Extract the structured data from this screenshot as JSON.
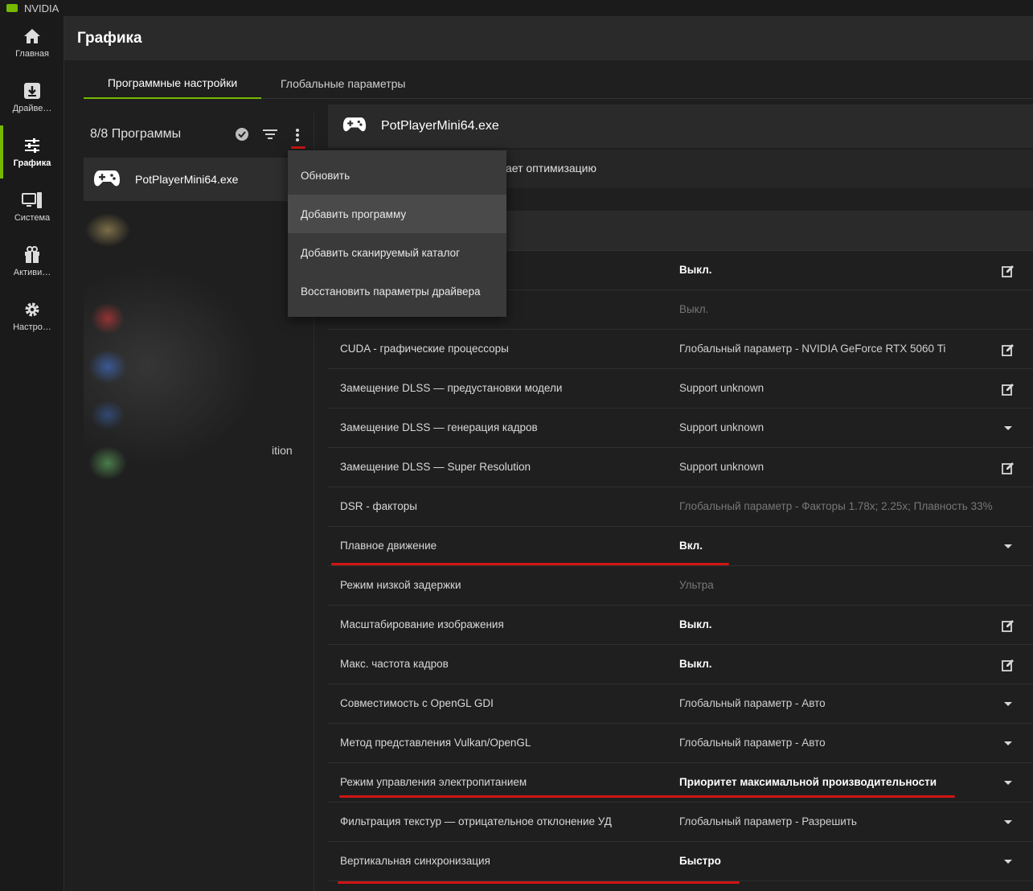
{
  "app": {
    "name": "NVIDIA",
    "page_title": "Графика"
  },
  "nav": [
    {
      "label": "Главная",
      "icon": "home-icon"
    },
    {
      "label": "Драйве…",
      "icon": "driver-icon"
    },
    {
      "label": "Графика",
      "icon": "sliders-icon",
      "active": true
    },
    {
      "label": "Система",
      "icon": "system-icon"
    },
    {
      "label": "Активи…",
      "icon": "gift-icon"
    },
    {
      "label": "Настро…",
      "icon": "gear-icon"
    }
  ],
  "tabs": [
    {
      "label": "Программные настройки",
      "active": true
    },
    {
      "label": "Глобальные параметры"
    }
  ],
  "programs": {
    "count_label": "8/8 Программы",
    "selected": "PotPlayerMini64.exe",
    "partial_text": "ition"
  },
  "menu": [
    {
      "label": "Обновить"
    },
    {
      "label": "Добавить программу",
      "highlighted": true
    },
    {
      "label": "Добавить сканируемый каталог"
    },
    {
      "label": "Восстановить параметры драйвера"
    }
  ],
  "app_panel": {
    "title": "PotPlayerMini64.exe",
    "optimization_text": "ает оптимизацию"
  },
  "settings": [
    {
      "name": "",
      "value": "Выкл.",
      "style": "strong",
      "control": "edit"
    },
    {
      "name": "",
      "value": "Выкл.",
      "style": "muted",
      "control": ""
    },
    {
      "name": "CUDA - графические процессоры",
      "value": "Глобальный параметр - NVIDIA GeForce RTX 5060 Ti",
      "style": "normal",
      "control": "edit"
    },
    {
      "name": "Замещение DLSS — предустановки модели",
      "value": "Support unknown",
      "style": "normal",
      "control": "edit"
    },
    {
      "name": "Замещение DLSS — генерация кадров",
      "value": "Support unknown",
      "style": "normal",
      "control": "dropdown"
    },
    {
      "name": "Замещение DLSS — Super Resolution",
      "value": "Support unknown",
      "style": "normal",
      "control": "edit"
    },
    {
      "name": "DSR - факторы",
      "value": "Глобальный параметр - Факторы 1.78x; 2.25x; Плавность 33%",
      "style": "muted",
      "control": ""
    },
    {
      "name": "Плавное движение",
      "value": "Вкл.",
      "style": "strong",
      "control": "dropdown"
    },
    {
      "name": "Режим низкой задержки",
      "value": "Ультра",
      "style": "muted",
      "control": ""
    },
    {
      "name": "Масштабирование изображения",
      "value": "Выкл.",
      "style": "strong",
      "control": "edit"
    },
    {
      "name": "Макс. частота кадров",
      "value": "Выкл.",
      "style": "strong",
      "control": "edit"
    },
    {
      "name": "Совместимость с OpenGL GDI",
      "value": "Глобальный параметр - Авто",
      "style": "normal",
      "control": "dropdown"
    },
    {
      "name": "Метод представления Vulkan/OpenGL",
      "value": "Глобальный параметр - Авто",
      "style": "normal",
      "control": "dropdown"
    },
    {
      "name": "Режим управления электропитанием",
      "value": "Приоритет максимальной производительности",
      "style": "strong",
      "control": "dropdown"
    },
    {
      "name": "Фильтрация текстур — отрицательное отклонение УД",
      "value": "Глобальный параметр - Разрешить",
      "style": "normal",
      "control": "dropdown"
    },
    {
      "name": "Вертикальная синхронизация",
      "value": "Быстро",
      "style": "strong",
      "control": "dropdown"
    }
  ],
  "colors": {
    "accent": "#76b900",
    "annotation": "#d11414"
  }
}
